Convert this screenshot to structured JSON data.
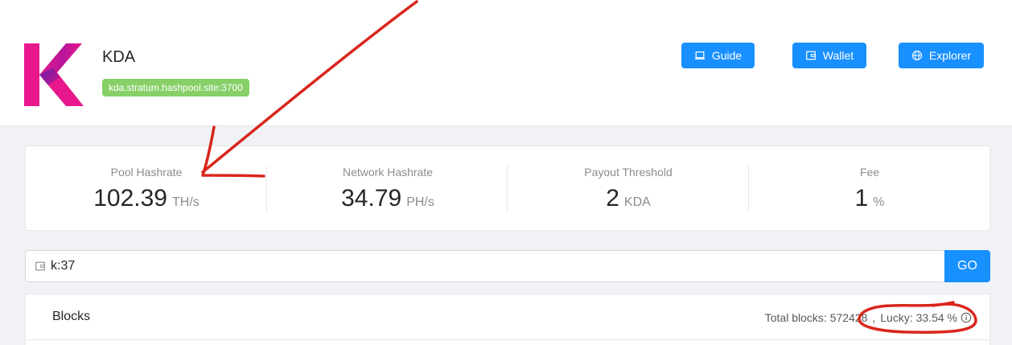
{
  "header": {
    "coin_name": "KDA",
    "stratum": "kda.stratum.hashpool.site:3700",
    "logo_letter": "K",
    "buttons": {
      "guide": "Guide",
      "wallet": "Wallet",
      "explorer": "Explorer"
    }
  },
  "stats": [
    {
      "title": "Pool Hashrate",
      "value": "102.39",
      "unit": "TH/s"
    },
    {
      "title": "Network Hashrate",
      "value": "34.79",
      "unit": "PH/s"
    },
    {
      "title": "Payout Threshold",
      "value": "2",
      "unit": "KDA"
    },
    {
      "title": "Fee",
      "value": "1",
      "unit": "%"
    }
  ],
  "search": {
    "value": "k:37",
    "go_label": "GO",
    "icon": "wallet-icon"
  },
  "blocks": {
    "title": "Blocks",
    "total_label": "Total blocks: 572428",
    "separator": ",",
    "lucky_label": "Lucky: 33.54 %",
    "info_icon": "info-circle-icon"
  },
  "colors": {
    "primary": "#1890ff",
    "tag": "#87d068",
    "logo_pink": "#e8178c",
    "logo_purple": "#6b1fa8",
    "annotation_red": "#d9261c"
  }
}
